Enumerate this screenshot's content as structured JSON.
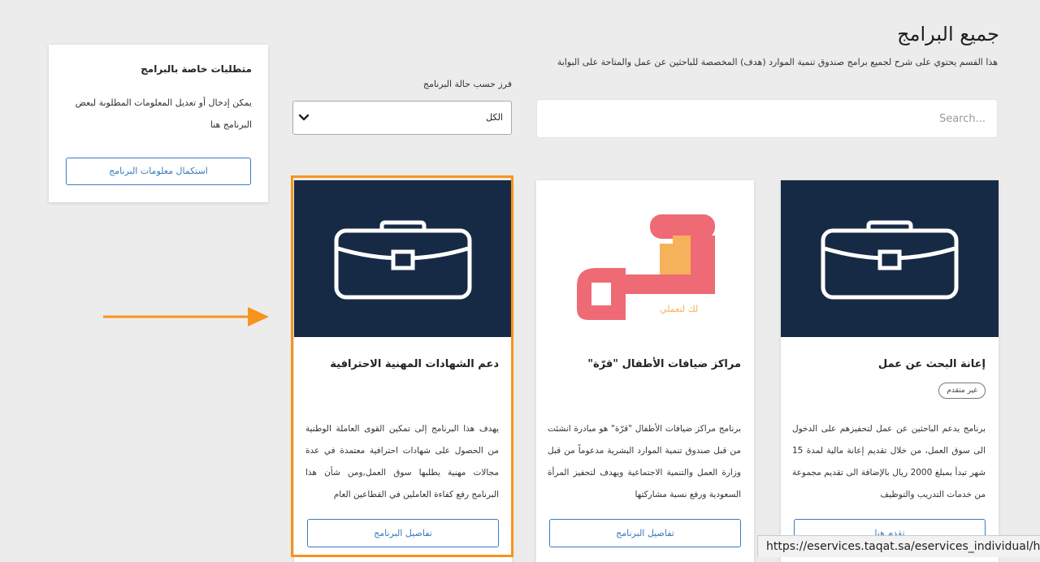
{
  "page": {
    "title": "جميع البرامج",
    "subtitle": "هذا القسم يحتوي على شرح لجميع برامج صندوق تنمية الموارد (هدف) المخصصة للباحثين عن عمل والمتاحة على البوابة"
  },
  "search": {
    "placeholder": "Search..."
  },
  "filter": {
    "label": "فرز حسب حالة البرنامج",
    "selected": "الكل",
    "icon": "chevron-down-icon"
  },
  "requirements": {
    "title": "متطلبات خاصة بالبرامج",
    "description": "يمكن إدخال أو تعديل المعلومات المطلوبة لبعض البرنامج هنا",
    "button_label": "استكمال معلومات البرنامج"
  },
  "programs": [
    {
      "title": "إعانة البحث عن عمل",
      "badge": "غير متقدم",
      "description": "برنامج يدعم الباحثين عن عمل لتحفيزهم على الدخول الى سوق العمل، من خلال تقديم إعانة مالية لمدة 15 شهر تبدأ بمبلغ 2000 ريال بالإضافة الى تقديم مجموعة من خدمات التدريب والتوظيف",
      "button_label": "تقدم هنا",
      "icon": "briefcase-icon"
    },
    {
      "title": "مراكز ضيافات الأطفال \"قرّة\"",
      "description": "برنامج مراكز ضيافات الأطفال \"قرّة\" هو مبادرة انشئت من قبل صندوق تنمية الموارد البشرية مدعوماً من قبل وزارة العمل والتنمية الاجتماعية ويهدف لتحفيز المرأة السعودية ورفع نسبة مشاركتها",
      "button_label": "تفاصيل البرنامج",
      "logo_caption": "لك لتعملي",
      "icon": "qurrah-logo"
    },
    {
      "title": "دعم الشهادات المهنية الاحترافية",
      "description": "يهدف هذا البرنامج إلى تمكين القوى العاملة الوطنية من الحصول على شهادات احترافية معتمدة في عدة مجالات مهنية يطلبها سوق العمل,ومن شأن هذا البرنامج رفع كفاءة العاملين في القطاعين العام",
      "button_label": "تفاصيل البرنامج",
      "icon": "briefcase-icon"
    }
  ],
  "annotation": {
    "color": "#f7941d"
  },
  "status_bar": {
    "url": "https://eservices.taqat.sa/eservices_individual/home.as"
  }
}
